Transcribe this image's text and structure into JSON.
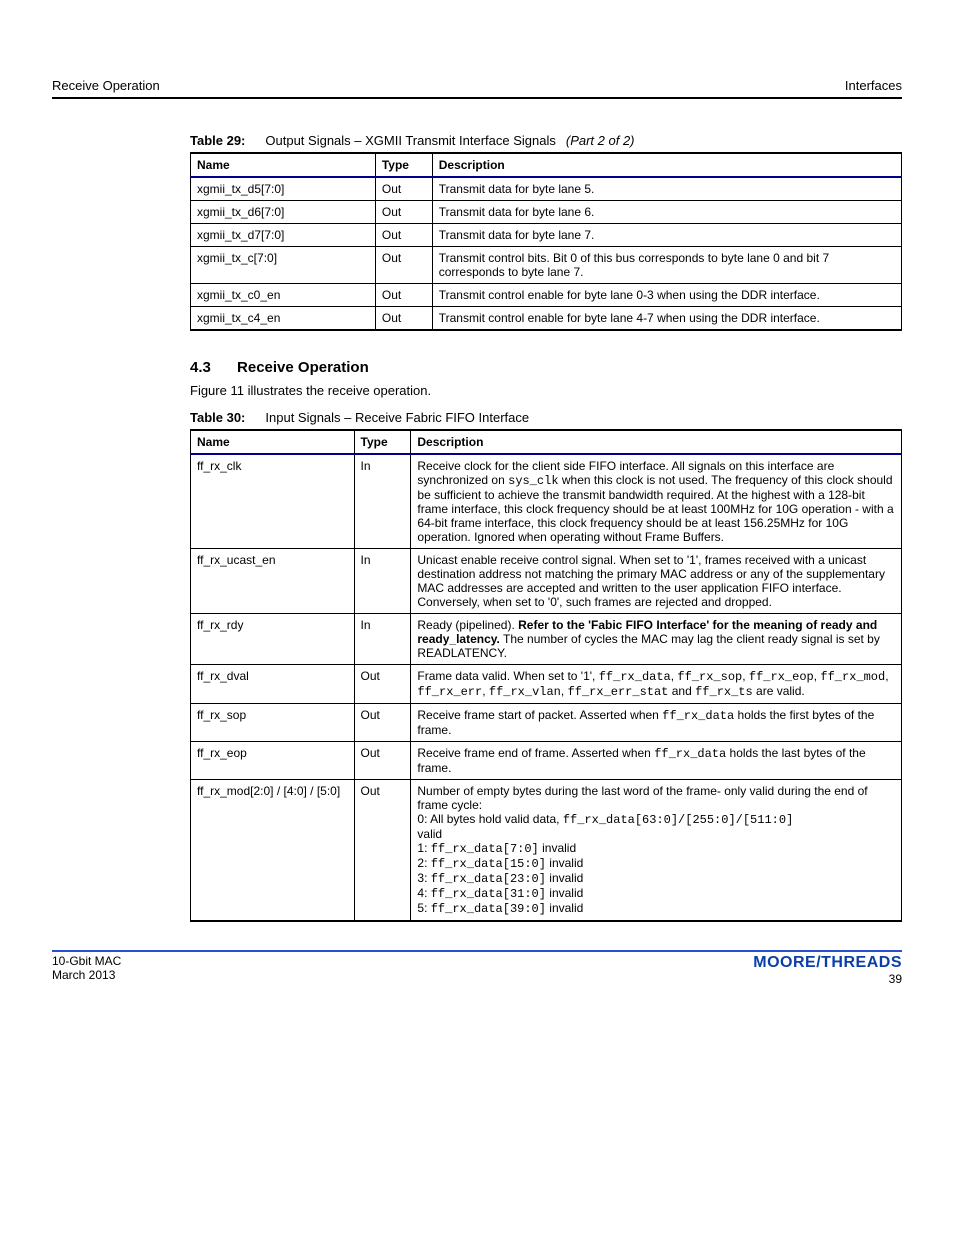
{
  "header": {
    "left": "Receive Operation",
    "right": "Interfaces"
  },
  "table29": {
    "label": "Table 29:",
    "title": "Output Signals – XGMII Transmit Interface Signals",
    "note": "(Part 2 of 2)",
    "cols": [
      "Name",
      "Type",
      "Description"
    ],
    "rows": [
      {
        "name": "xgmii_tx_d5[7:0]",
        "type": "Out",
        "desc": "Transmit data for byte lane 5."
      },
      {
        "name": "xgmii_tx_d6[7:0]",
        "type": "Out",
        "desc": "Transmit data for byte lane 6."
      },
      {
        "name": "xgmii_tx_d7[7:0]",
        "type": "Out",
        "desc": "Transmit data for byte lane 7."
      },
      {
        "name": "xgmii_tx_c[7:0]",
        "type": "Out",
        "desc": "Transmit control bits. Bit 0 of this bus corresponds to byte lane 0 and bit 7 corresponds to byte lane 7."
      },
      {
        "name": "xgmii_tx_c0_en",
        "type": "Out",
        "desc": "Transmit control enable for byte lane 0-3 when using the DDR interface."
      },
      {
        "name": "xgmii_tx_c4_en",
        "type": "Out",
        "desc": "Transmit control enable for byte lane 4-7 when using the DDR interface."
      }
    ]
  },
  "section": {
    "number": "4.3",
    "title": "Receive Operation",
    "para": "Figure 11 illustrates the receive operation."
  },
  "table30": {
    "label": "Table 30:",
    "title": "Input Signals – Receive Fabric FIFO Interface",
    "cols": [
      "Name",
      "Type",
      "Description"
    ],
    "rows": [
      {
        "name": "ff_rx_clk",
        "type": "In",
        "desc_parts": [
          "Receive clock for the client side FIFO interface. All signals on this interface are synchronized on ",
          {
            "mono": "sys_clk"
          },
          " when this clock is not used. The frequency of this clock should be sufficient to achieve the transmit bandwidth required. At the highest with a 128-bit frame interface, this clock frequency should be at least 100MHz for 10G operation - with a 64-bit frame interface, this clock frequency should be at least 156.25MHz for 10G operation. Ignored when operating without Frame Buffers."
        ]
      },
      {
        "name": "ff_rx_ucast_en",
        "type": "In",
        "desc": "Unicast enable receive control signal. When set to '1', frames received with a unicast destination address not matching the primary MAC address or any of the supplementary MAC addresses are accepted and written to the user application FIFO interface. Conversely, when set to '0', such frames are rejected and dropped."
      },
      {
        "name": "ff_rx_rdy",
        "type": "In",
        "desc_parts": [
          "Ready (pipelined). ",
          {
            "bold": "Refer to the 'Fabic FIFO Interface' for the meaning of ready and ready_latency."
          },
          " The number of cycles the MAC may lag the client ready signal is set by READLATENCY."
        ]
      },
      {
        "name": "ff_rx_dval",
        "type": "Out",
        "desc_parts": [
          "Frame data valid. When set to '1', ",
          {
            "mono": "ff_rx_data"
          },
          ", ",
          {
            "mono": "ff_rx_sop"
          },
          ", ",
          {
            "mono": "ff_rx_eop"
          },
          ", ",
          {
            "mono": "ff_rx_mod"
          },
          ", ",
          {
            "mono": "ff_rx_err"
          },
          ", ",
          {
            "mono": "ff_rx_vlan"
          },
          ", ",
          {
            "mono": "ff_rx_err_stat"
          },
          " and ",
          {
            "mono": "ff_rx_ts"
          },
          " are valid."
        ]
      },
      {
        "name": "ff_rx_sop",
        "type": "Out",
        "desc_parts": [
          "Receive frame start of packet. Asserted when ",
          {
            "mono": "ff_rx_data"
          },
          " holds the first bytes of the frame."
        ]
      },
      {
        "name": "ff_rx_eop",
        "type": "Out",
        "desc_parts": [
          "Receive frame end of frame. Asserted when ",
          {
            "mono": "ff_rx_data"
          },
          " holds the last bytes of the frame."
        ]
      },
      {
        "name": "ff_rx_mod[2:0] / [4:0] / [5:0]",
        "type": "Out",
        "lines": [
          "Number of empty bytes during the last word of the frame- only valid during the end of frame cycle:",
          {
            "pair": [
              "0: All bytes hold valid data, ",
              "ff_rx_data[63:0]/[255:0]/[511:0]"
            ]
          },
          "valid",
          {
            "pair": [
              "1: ",
              "ff_rx_data[7:0]",
              " invalid"
            ]
          },
          {
            "pair": [
              "2: ",
              "ff_rx_data[15:0]",
              " invalid"
            ]
          },
          {
            "pair": [
              "3: ",
              "ff_rx_data[23:0]",
              " invalid"
            ]
          },
          {
            "pair": [
              "4: ",
              "ff_rx_data[31:0]",
              " invalid"
            ]
          },
          {
            "pair": [
              "5: ",
              "ff_rx_data[39:0]",
              " invalid"
            ]
          }
        ]
      }
    ]
  },
  "footer": {
    "left_line1": "10-Gbit MAC",
    "left_line2": "March 2013",
    "brand": "MOORE/THREADS",
    "page": "39"
  }
}
